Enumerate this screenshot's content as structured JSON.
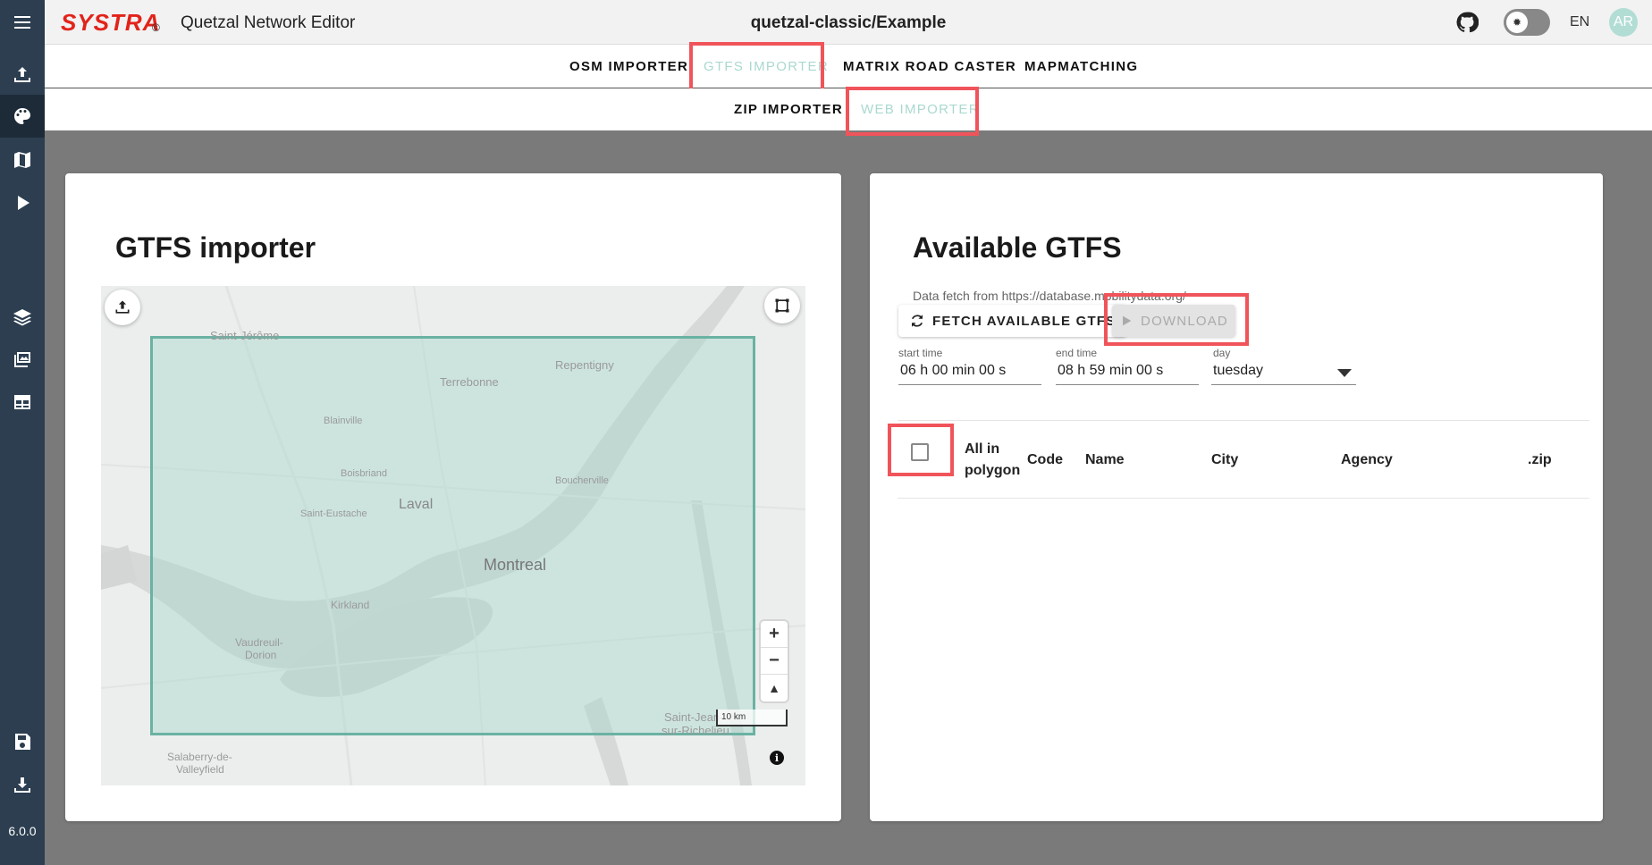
{
  "topbar": {
    "logo": "SYSTRA",
    "logo_mark": "©",
    "app_title": "Quetzal Network Editor",
    "project": "quetzal-classic/Example",
    "language": "EN",
    "avatar_initials": "AR",
    "icons": [
      "menu-icon",
      "github-icon",
      "theme-toggle-icon"
    ]
  },
  "sidebar": {
    "items": [
      {
        "icon": "upload-icon"
      },
      {
        "icon": "palette-icon",
        "active": true
      },
      {
        "icon": "map-icon"
      },
      {
        "icon": "play-icon"
      },
      {
        "icon": "layers-icon"
      },
      {
        "icon": "image-icon"
      },
      {
        "icon": "table-icon"
      },
      {
        "icon": "save-icon"
      },
      {
        "icon": "download-icon"
      }
    ],
    "version": "6.0.0"
  },
  "tabs_main": [
    {
      "label": "OSM IMPORTER",
      "active": false
    },
    {
      "label": "GTFS IMPORTER",
      "active": true
    },
    {
      "label": "MATRIX ROAD CASTER",
      "active": false
    },
    {
      "label": "MAPMATCHING",
      "active": false
    }
  ],
  "tabs_sub": [
    {
      "label": "ZIP IMPORTER",
      "active": false
    },
    {
      "label": "WEB IMPORTER",
      "active": true
    }
  ],
  "left_card": {
    "title": "GTFS importer",
    "map": {
      "places": [
        "Saint-Jérôme",
        "Repentigny",
        "Terrebonne",
        "Blainville",
        "Boisbriand",
        "Boucherville",
        "Laval",
        "Saint-Eustache",
        "Montreal",
        "Kirkland",
        "Vaudreuil-",
        "Dorion",
        "Saint-Jean-",
        "sur-Richelieu",
        "Salaberry-de-",
        "Valleyfield"
      ],
      "scale_label": "10 km",
      "zoom_in": "+",
      "zoom_out": "−",
      "compass": "▲",
      "info": "i"
    }
  },
  "right_card": {
    "title": "Available GTFS",
    "fetch_note": "Data fetch from https://database.mobilitydata.org/",
    "fetch_button": "FETCH AVAILABLE GTFS",
    "download_button": "DOWNLOAD",
    "start_time": {
      "label": "start time",
      "value": "06 h 00 min 00 s"
    },
    "end_time": {
      "label": "end time",
      "value": "08 h 59 min 00 s"
    },
    "day": {
      "label": "day",
      "value": "tuesday"
    },
    "table_headers": {
      "all_in_polygon_1": "All in",
      "all_in_polygon_2": "polygon",
      "code": "Code",
      "name": "Name",
      "city": "City",
      "agency": "Agency",
      "zip": ".zip"
    }
  },
  "colors": {
    "sidebar": "#2c3e50",
    "accent": "#aad9cf",
    "highlight": "#f0545a",
    "brand": "#e2231a"
  }
}
